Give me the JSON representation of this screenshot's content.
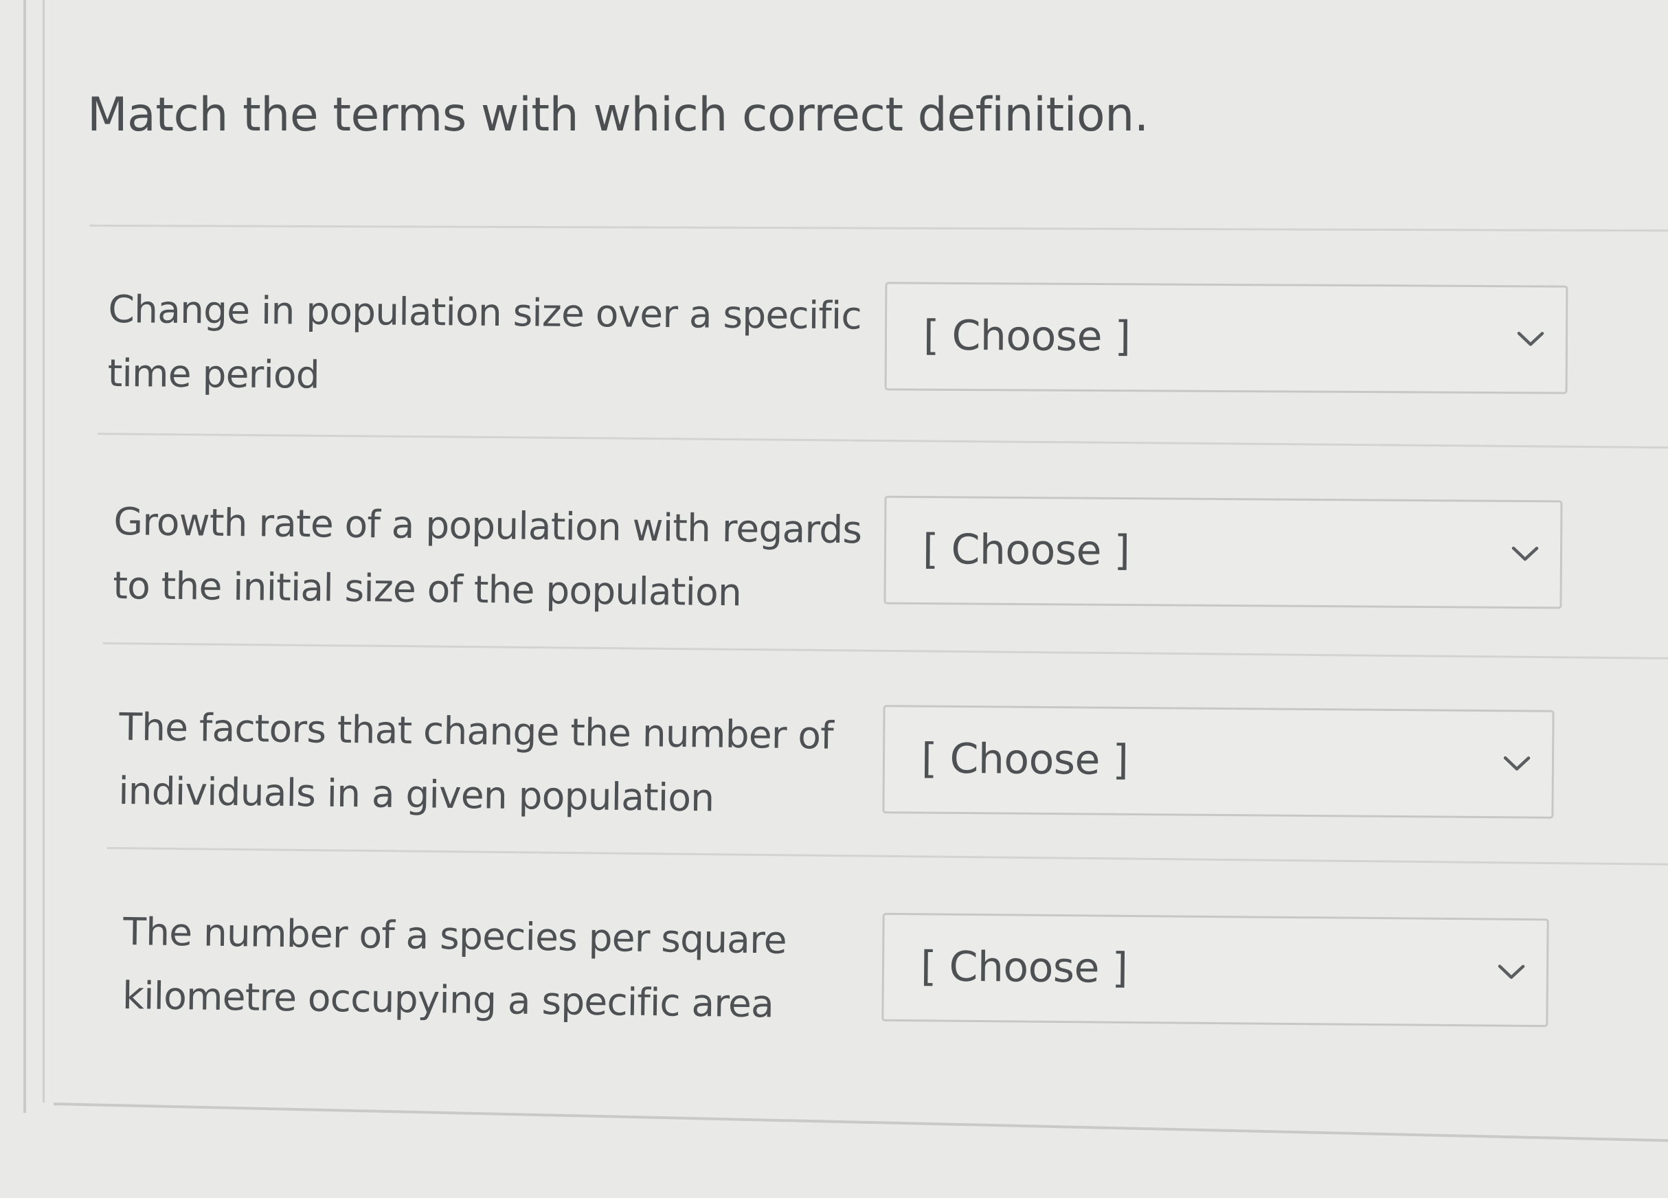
{
  "question": {
    "prompt": "Match the terms with which correct definition."
  },
  "rows": [
    {
      "term_line1": "Change in population size over a specific",
      "term_line2": "time period",
      "select_value": "[ Choose ]",
      "icon": "chevron-down-icon"
    },
    {
      "term_line1": "Growth rate of a population with regards",
      "term_line2": "to the initial size of the population",
      "select_value": "[ Choose ]",
      "icon": "chevron-down-icon"
    },
    {
      "term_line1": "The factors that change the number of",
      "term_line2": "individuals in a given population",
      "select_value": "[ Choose ]",
      "icon": "chevron-down-icon"
    },
    {
      "term_line1": "The number of a species per square",
      "term_line2": "kilometre occupying a specific area",
      "select_value": "[ Choose ]",
      "icon": "chevron-down-icon"
    }
  ],
  "colors": {
    "background": "#e9e9e7",
    "text": "#4c4f52",
    "border": "#c7c8c6"
  }
}
